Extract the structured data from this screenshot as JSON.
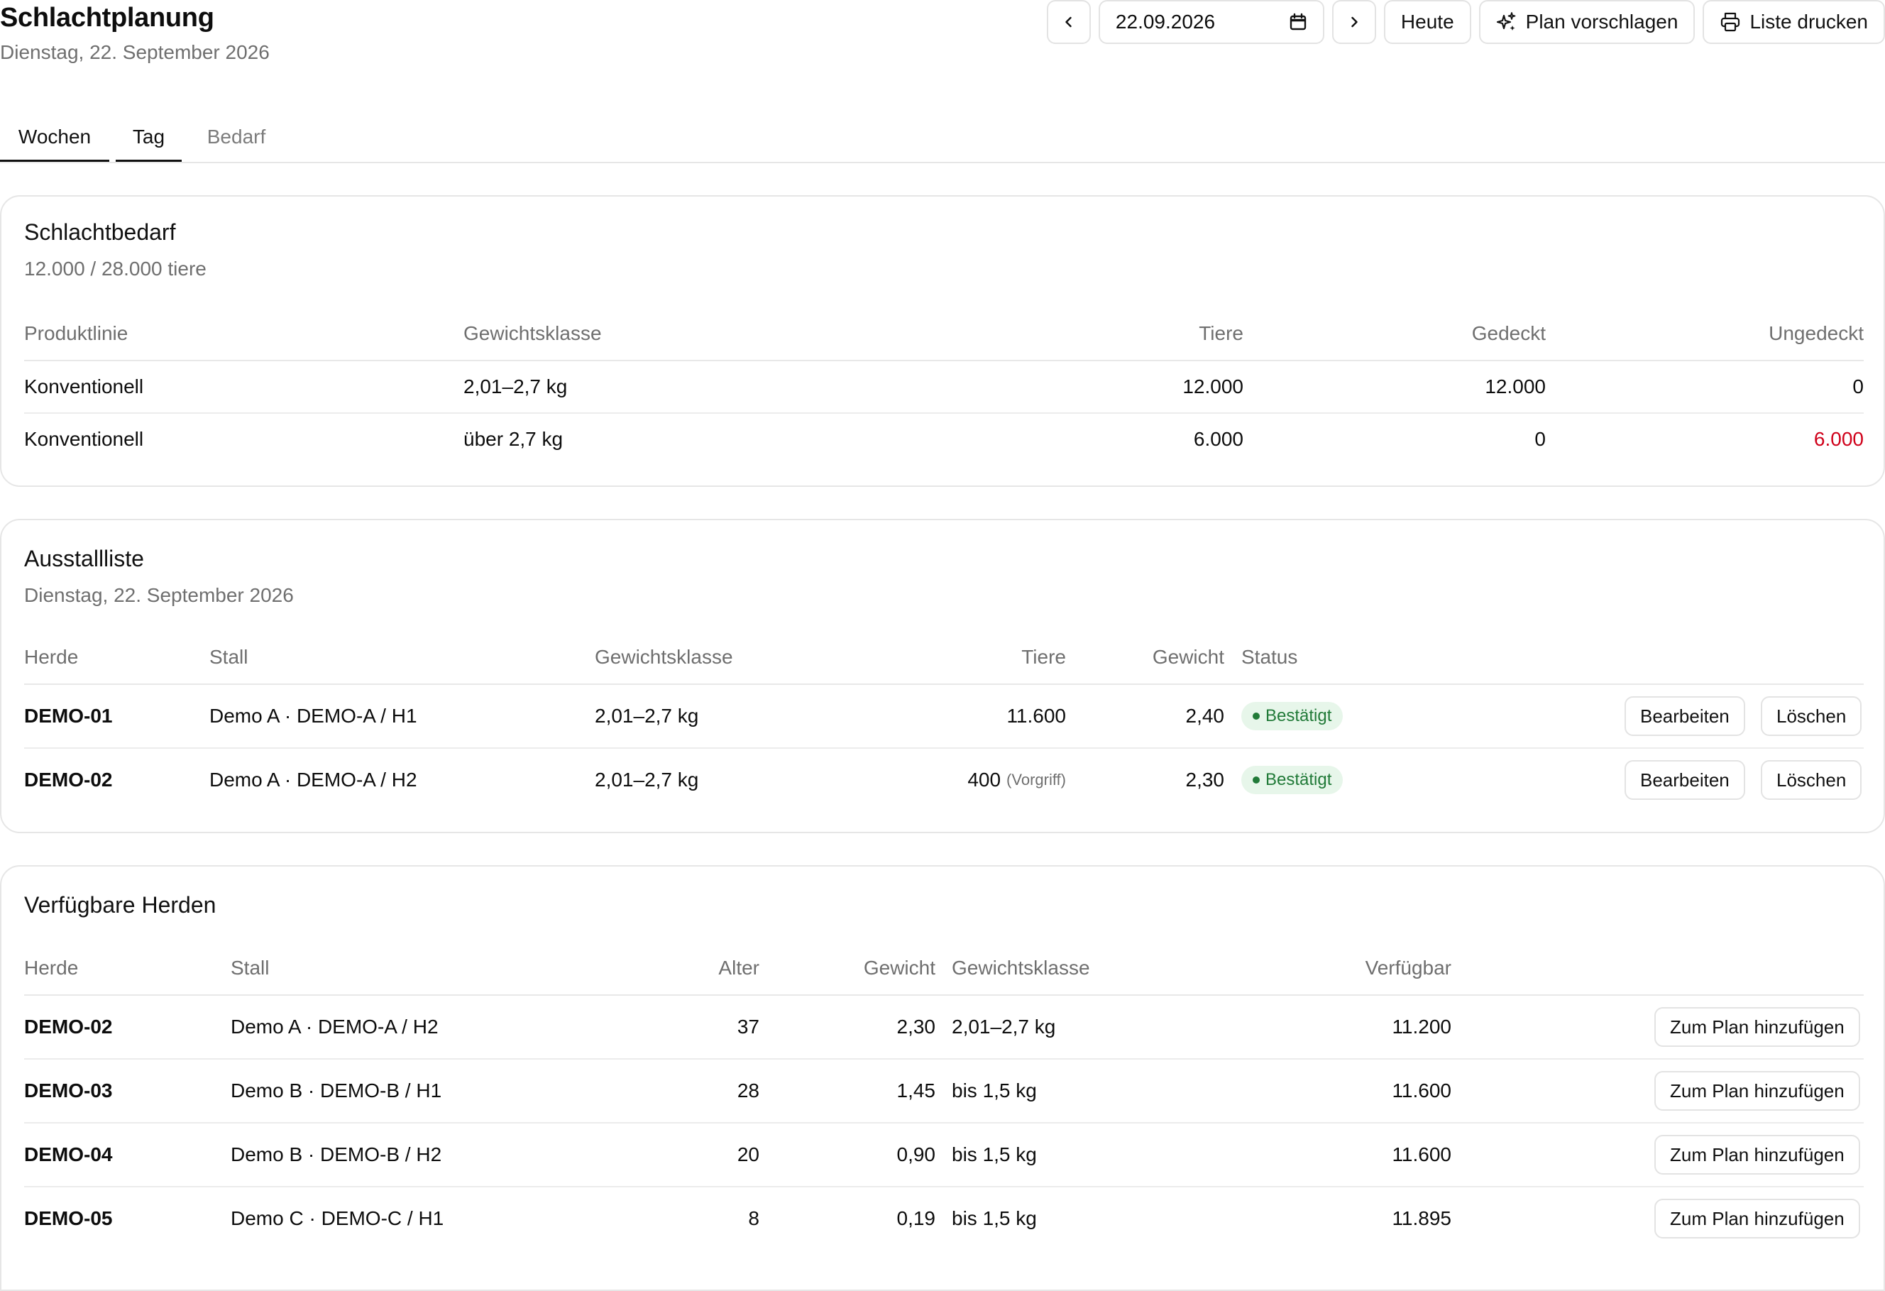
{
  "header": {
    "title": "Schlachtplanung",
    "subtitle": "Dienstag, 22. September 2026"
  },
  "toolbar": {
    "prev_icon": "chevron-left-icon",
    "date_value": "22.09.2026",
    "calendar_icon": "calendar-icon",
    "next_icon": "chevron-right-icon",
    "today_label": "Heute",
    "suggest_label": "Plan vorschlagen",
    "suggest_icon": "sparkles-icon",
    "print_label": "Liste drucken",
    "print_icon": "printer-icon"
  },
  "tabs": [
    {
      "label": "Wochen",
      "active": true
    },
    {
      "label": "Tag",
      "active": true
    },
    {
      "label": "Bedarf",
      "active": false
    }
  ],
  "demand": {
    "title": "Schlachtbedarf",
    "summary": "12.000 / 28.000 tiere",
    "columns": [
      "Produktlinie",
      "Gewichtsklasse",
      "Tiere",
      "Gedeckt",
      "Ungedeckt"
    ],
    "rows": [
      {
        "line": "Konventionell",
        "weight_class": "2,01–2,7 kg",
        "animals": "12.000",
        "covered": "12.000",
        "uncovered": "0"
      },
      {
        "line": "Konventionell",
        "weight_class": "über 2,7 kg",
        "animals": "6.000",
        "covered": "0",
        "uncovered": "6.000"
      }
    ],
    "uncovered_color": "#d0021b"
  },
  "removal": {
    "title": "Ausstallliste",
    "subtitle": "Dienstag, 22. September 2026",
    "columns": [
      "Herde",
      "Stall",
      "Gewichtsklasse",
      "Tiere",
      "Gewicht",
      "Status"
    ],
    "rows": [
      {
        "herd": "DEMO-01",
        "barn": "Demo A · DEMO-A / H1",
        "weight_class": "2,01–2,7 kg",
        "animals": "11.600",
        "note": "",
        "weight": "2,40",
        "status": "Bestätigt",
        "edit": "Bearbeiten",
        "delete": "Löschen"
      },
      {
        "herd": "DEMO-02",
        "barn": "Demo A · DEMO-A / H2",
        "weight_class": "2,01–2,7 kg",
        "animals": "400",
        "note": "(Vorgriff)",
        "weight": "2,30",
        "status": "Bestätigt",
        "edit": "Bearbeiten",
        "delete": "Löschen"
      }
    ],
    "status_color": "#217a38"
  },
  "herds": {
    "title": "Verfügbare Herden",
    "columns": [
      "Herde",
      "Stall",
      "Alter",
      "Gewicht",
      "Gewichtsklasse",
      "Verfügbar"
    ],
    "rows": [
      {
        "herd": "DEMO-02",
        "barn": "Demo A · DEMO-A / H2",
        "age": "37",
        "weight": "2,30",
        "weight_class": "2,01–2,7 kg",
        "available": "11.200",
        "action": "Zum Plan hinzufügen"
      },
      {
        "herd": "DEMO-03",
        "barn": "Demo B · DEMO-B / H1",
        "age": "28",
        "weight": "1,45",
        "weight_class": "bis 1,5 kg",
        "available": "11.600",
        "action": "Zum Plan hinzufügen"
      },
      {
        "herd": "DEMO-04",
        "barn": "Demo B · DEMO-B / H2",
        "age": "20",
        "weight": "0,90",
        "weight_class": "bis 1,5 kg",
        "available": "11.600",
        "action": "Zum Plan hinzufügen"
      },
      {
        "herd": "DEMO-05",
        "barn": "Demo C · DEMO-C / H1",
        "age": "8",
        "weight": "0,19",
        "weight_class": "bis 1,5 kg",
        "available": "11.895",
        "action": "Zum Plan hinzufügen"
      }
    ]
  }
}
